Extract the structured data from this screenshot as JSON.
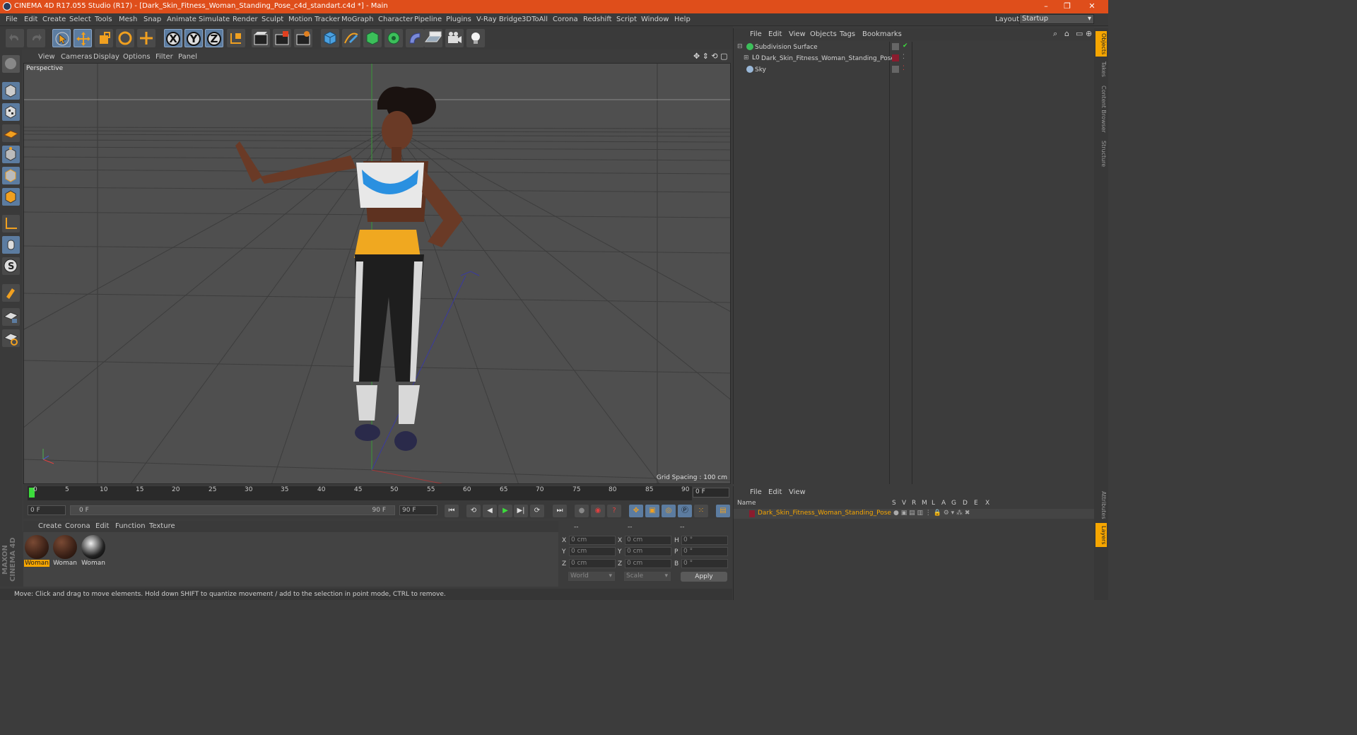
{
  "window": {
    "title": "CINEMA 4D R17.055 Studio (R17) - [Dark_Skin_Fitness_Woman_Standing_Pose_c4d_standart.c4d *] - Main",
    "controls": [
      "–",
      "❐",
      "✕"
    ]
  },
  "menubar": {
    "items": [
      "File",
      "Edit",
      "Create",
      "Select",
      "Tools",
      "Mesh",
      "Snap",
      "Animate",
      "Simulate",
      "Render",
      "Sculpt",
      "Motion Tracker",
      "MoGraph",
      "Character",
      "Pipeline",
      "Plugins",
      "V-Ray Bridge",
      "3DToAll",
      "Corona",
      "Redshift",
      "Script",
      "Window",
      "Help"
    ],
    "layout_label": "Layout:",
    "layout_value": "Startup"
  },
  "toolbar": {
    "axis_x": "X",
    "axis_y": "Y",
    "axis_z": "Z"
  },
  "viewport": {
    "menu": [
      "View",
      "Cameras",
      "Display",
      "Options",
      "Filter",
      "Panel"
    ],
    "label": "Perspective",
    "grid_spacing": "Grid Spacing : 100 cm"
  },
  "timeline": {
    "ticks": [
      "0",
      "5",
      "10",
      "15",
      "20",
      "25",
      "30",
      "35",
      "40",
      "45",
      "50",
      "55",
      "60",
      "65",
      "70",
      "75",
      "80",
      "85",
      "90"
    ],
    "current_frame": "0 F",
    "start_field": "0 F",
    "range_start": "0 F",
    "range_end": "90 F",
    "end_field": "90 F"
  },
  "material_manager": {
    "menu": [
      "Create",
      "Corona",
      "Edit",
      "Function",
      "Texture"
    ],
    "materials": [
      {
        "name": "Woman",
        "selected": true
      },
      {
        "name": "Woman",
        "selected": false
      },
      {
        "name": "Woman",
        "selected": false
      }
    ]
  },
  "coordinates": {
    "headers": [
      "--",
      "--",
      "--"
    ],
    "rows": [
      {
        "a_label": "X",
        "a_val": "0 cm",
        "b_label": "X",
        "b_val": "0 cm",
        "c_label": "H",
        "c_val": "0 °"
      },
      {
        "a_label": "Y",
        "a_val": "0 cm",
        "b_label": "Y",
        "b_val": "0 cm",
        "c_label": "P",
        "c_val": "0 °"
      },
      {
        "a_label": "Z",
        "a_val": "0 cm",
        "b_label": "Z",
        "b_val": "0 cm",
        "c_label": "B",
        "c_val": "0 °"
      }
    ],
    "mode_select": "World",
    "scale_select": "Scale",
    "apply": "Apply"
  },
  "status": "Move: Click and drag to move elements. Hold down SHIFT to quantize movement / add to the selection in point mode, CTRL to remove.",
  "branding": "MAXON CINEMA 4D",
  "object_manager": {
    "menu": [
      "File",
      "Edit",
      "View",
      "Objects",
      "Tags",
      "Bookmarks"
    ],
    "objects": [
      {
        "name": "Subdivision Surface"
      },
      {
        "name": "Dark_Skin_Fitness_Woman_Standing_Pose"
      },
      {
        "name": "Sky"
      }
    ]
  },
  "layer_manager": {
    "menu": [
      "File",
      "Edit",
      "View"
    ],
    "columns": [
      "Name",
      "S",
      "V",
      "R",
      "M",
      "L",
      "A",
      "G",
      "D",
      "E",
      "X"
    ],
    "layer_name": "Dark_Skin_Fitness_Woman_Standing_Pose"
  },
  "right_tabs": [
    "Objects",
    "Takes",
    "Content Browser",
    "Structure",
    "Attributes",
    "Layers"
  ],
  "colors": {
    "title_bar": "#df4e1b",
    "selection": "#f7a600",
    "layer_color": "#8a1c2e"
  }
}
